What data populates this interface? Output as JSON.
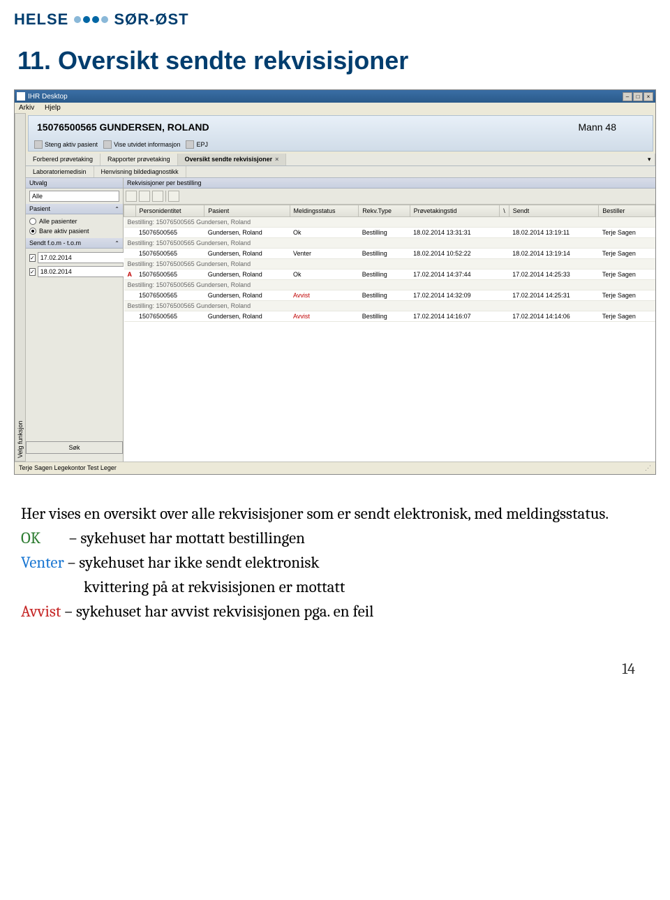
{
  "logo": {
    "part1": "HELSE",
    "part2": "SØR-ØST"
  },
  "heading": "11. Oversikt sendte rekvisisjoner",
  "app": {
    "title": "IHR Desktop",
    "menu": {
      "arkiv": "Arkiv",
      "hjelp": "Hjelp"
    },
    "vtab": "Velg funksjon",
    "patient": {
      "id_name": "15076500565 GUNDERSEN, ROLAND",
      "info": "Mann 48"
    },
    "toolbar": {
      "steng": "Steng aktiv pasient",
      "vis": "Vise utvidet informasjon",
      "epj": "EPJ"
    },
    "tabs1": {
      "forbered": "Forbered prøvetaking",
      "rapporter": "Rapporter prøvetaking",
      "oversikt": "Oversikt sendte rekvisisjoner"
    },
    "tabs2": {
      "lab": "Laboratoriemedisin",
      "henv": "Henvisning bildediagnostikk"
    },
    "sidebar": {
      "utvalg_hdr": "Utvalg",
      "alle": "Alle",
      "pasient_hdr": "Pasient",
      "alle_pasienter": "Alle pasienter",
      "bare_aktiv": "Bare aktiv pasient",
      "sendt_hdr": "Sendt f.o.m - t.o.m",
      "date1": "17.02.2014",
      "date2": "18.02.2014",
      "sok": "Søk"
    },
    "table": {
      "section_hdr": "Rekvisisjoner per bestilling",
      "columns": {
        "personid": "Personidentitet",
        "pasient": "Pasient",
        "meldingsstatus": "Meldingsstatus",
        "rekvtype": "Rekv.Type",
        "provetakingstid": "Prøvetakingstid",
        "sendt": "Sendt",
        "bestiller": "Bestiller"
      },
      "group_label": "Bestilling: 15076500565 Gundersen, Roland",
      "rows": [
        {
          "alert": "",
          "pid": "15076500565",
          "pasient": "Gundersen, Roland",
          "status": "Ok",
          "type": "Bestilling",
          "tid": "18.02.2014 13:31:31",
          "sendt": "18.02.2014 13:19:11",
          "bestiller": "Terje Sagen"
        },
        {
          "alert": "",
          "pid": "15076500565",
          "pasient": "Gundersen, Roland",
          "status": "Venter",
          "type": "Bestilling",
          "tid": "18.02.2014 10:52:22",
          "sendt": "18.02.2014 13:19:14",
          "bestiller": "Terje Sagen"
        },
        {
          "alert": "A",
          "pid": "15076500565",
          "pasient": "Gundersen, Roland",
          "status": "Ok",
          "type": "Bestilling",
          "tid": "17.02.2014 14:37:44",
          "sendt": "17.02.2014 14:25:33",
          "bestiller": "Terje Sagen"
        },
        {
          "alert": "",
          "pid": "15076500565",
          "pasient": "Gundersen, Roland",
          "status": "Avvist",
          "type": "Bestilling",
          "tid": "17.02.2014 14:32:09",
          "sendt": "17.02.2014 14:25:31",
          "bestiller": "Terje Sagen"
        },
        {
          "alert": "",
          "pid": "15076500565",
          "pasient": "Gundersen, Roland",
          "status": "Avvist",
          "type": "Bestilling",
          "tid": "17.02.2014 14:16:07",
          "sendt": "17.02.2014 14:14:06",
          "bestiller": "Terje Sagen"
        }
      ]
    },
    "statusbar": "Terje Sagen  Legekontor Test  Leger"
  },
  "body": {
    "p1": "Her vises en oversikt over alle rekvisisjoner som er sendt elektronisk, med meldingsstatus.",
    "ok_label": "OK",
    "ok_text": " – sykehuset har mottatt bestillingen",
    "venter_label": "Venter",
    "venter_text": " – sykehuset har ikke sendt elektronisk",
    "venter_text2": "kvittering på at rekvisisjonen er mottatt",
    "avvist_label": "Avvist",
    "avvist_text": " – sykehuset har avvist rekvisisjonen pga. en feil"
  },
  "page_num": "14",
  "colors": {
    "brand_blue": "#003d6e",
    "dot_light": "#8ab8d8",
    "dot_dark": "#0066a4"
  }
}
